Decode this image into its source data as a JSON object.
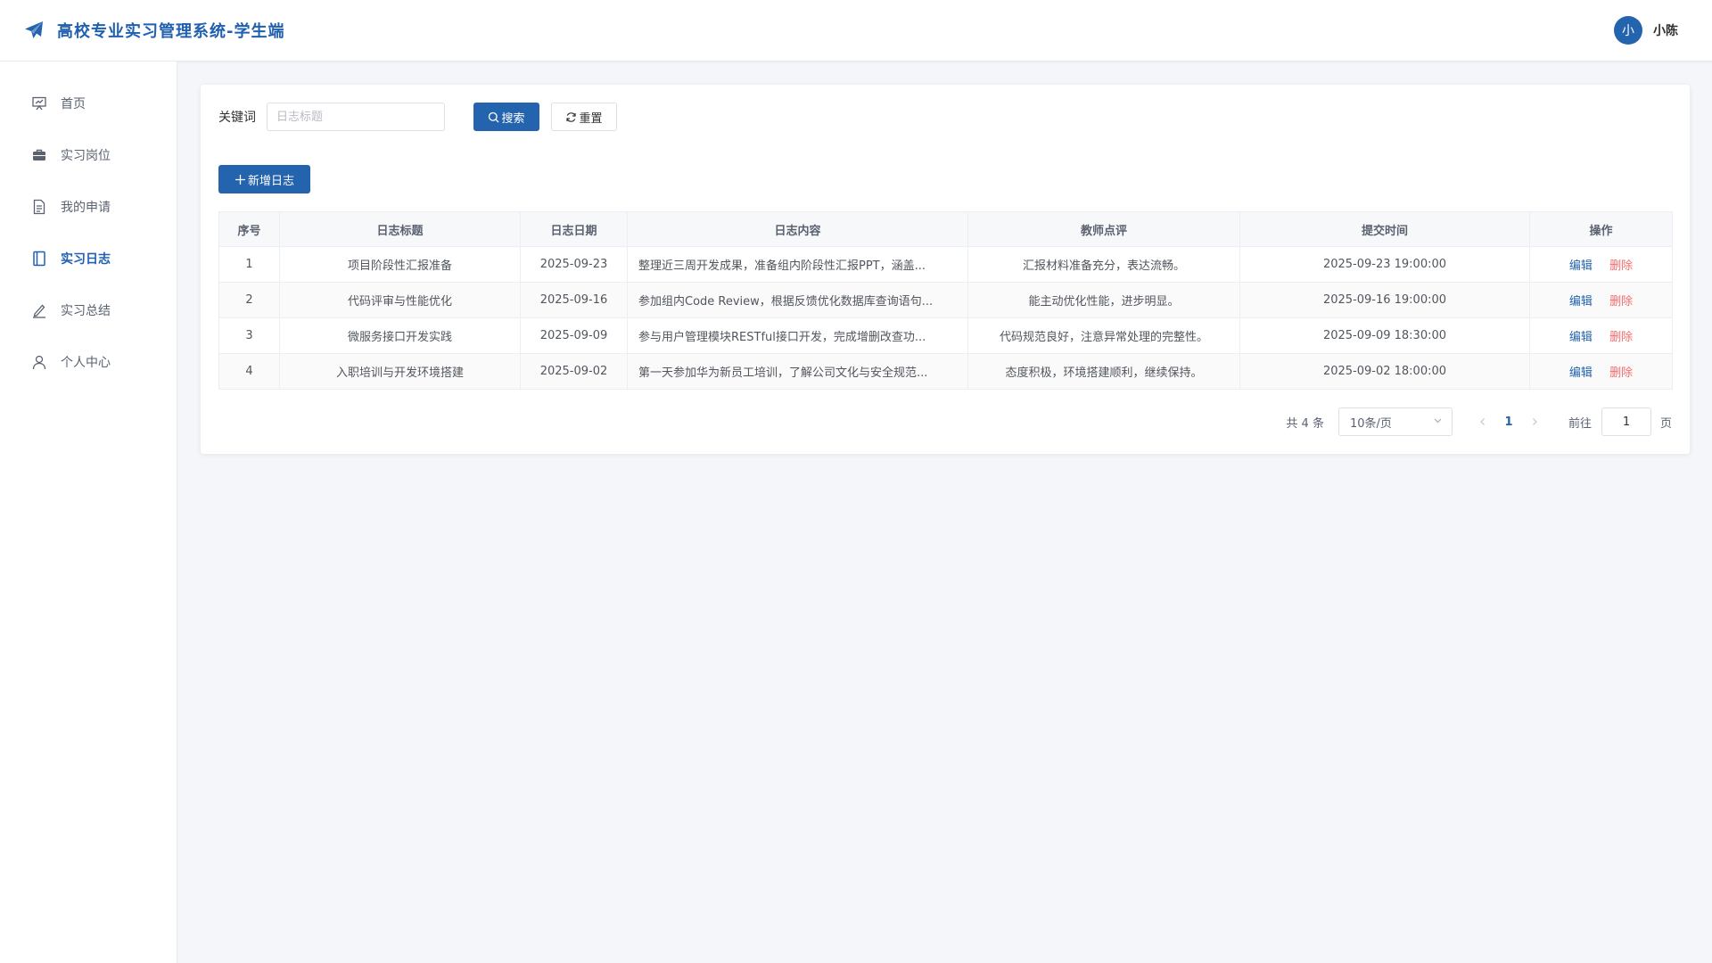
{
  "app": {
    "title": "高校专业实习管理系统-学生端",
    "brand_icon": "paper-plane-icon",
    "user_initial": "小",
    "user_name": "小陈",
    "accent_color": "#2463ae"
  },
  "sidebar": {
    "items": [
      {
        "label": "首页",
        "icon": "presentation-icon",
        "active": false
      },
      {
        "label": "实习岗位",
        "icon": "briefcase-icon",
        "active": false
      },
      {
        "label": "我的申请",
        "icon": "document-icon",
        "active": false
      },
      {
        "label": "实习日志",
        "icon": "notebook-icon",
        "active": true
      },
      {
        "label": "实习总结",
        "icon": "pen-icon",
        "active": false
      },
      {
        "label": "个人中心",
        "icon": "user-icon",
        "active": false
      }
    ]
  },
  "search": {
    "label": "关键词",
    "placeholder": "日志标题",
    "value": "",
    "search_label": "搜索",
    "reset_label": "重置"
  },
  "toolbar": {
    "add_label": "新增日志"
  },
  "table": {
    "headers": [
      "序号",
      "日志标题",
      "日志日期",
      "日志内容",
      "教师点评",
      "提交时间",
      "操作"
    ],
    "rows": [
      {
        "no": "1",
        "title": "项目阶段性汇报准备",
        "date": "2025-09-23",
        "content": "整理近三周开发成果，准备组内阶段性汇报PPT，涵盖...",
        "comment": "汇报材料准备充分，表达流畅。",
        "submitted": "2025-09-23 19:00:00",
        "edit": "编辑",
        "delete": "删除"
      },
      {
        "no": "2",
        "title": "代码评审与性能优化",
        "date": "2025-09-16",
        "content": "参加组内Code Review，根据反馈优化数据库查询语句...",
        "comment": "能主动优化性能，进步明显。",
        "submitted": "2025-09-16 19:00:00",
        "edit": "编辑",
        "delete": "删除"
      },
      {
        "no": "3",
        "title": "微服务接口开发实践",
        "date": "2025-09-09",
        "content": "参与用户管理模块RESTful接口开发，完成增删改查功...",
        "comment": "代码规范良好，注意异常处理的完整性。",
        "submitted": "2025-09-09 18:30:00",
        "edit": "编辑",
        "delete": "删除"
      },
      {
        "no": "4",
        "title": "入职培训与开发环境搭建",
        "date": "2025-09-02",
        "content": "第一天参加华为新员工培训，了解公司文化与安全规范...",
        "comment": "态度积极，环境搭建顺利，继续保持。",
        "submitted": "2025-09-02 18:00:00",
        "edit": "编辑",
        "delete": "删除"
      }
    ]
  },
  "pagination": {
    "total_text": "共 4 条",
    "page_size": "10条/页",
    "current_page": "1",
    "goto_label": "前往",
    "goto_value": "1",
    "page_unit": "页"
  }
}
